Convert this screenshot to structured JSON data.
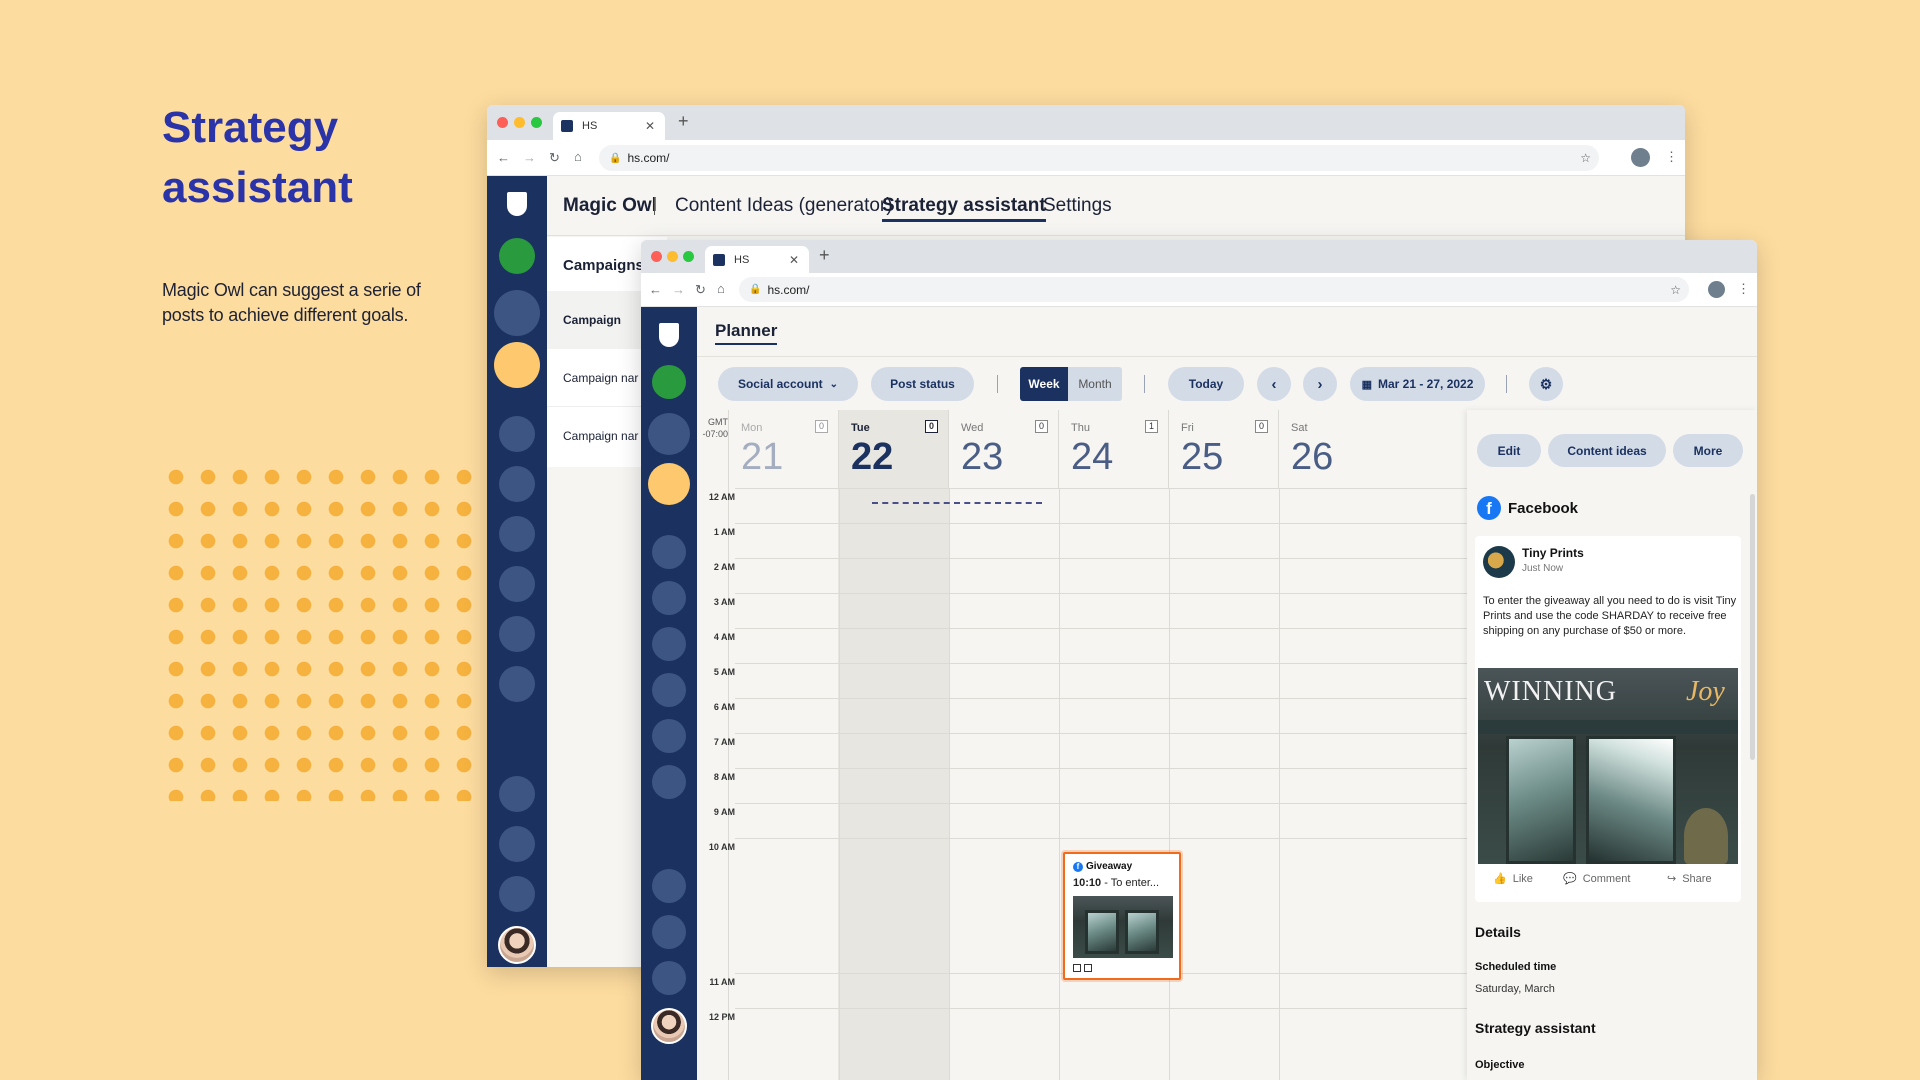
{
  "promo": {
    "title_line1": "Strategy",
    "title_line2": "assistant",
    "description": "Magic Owl can suggest a serie of posts to achieve different goals."
  },
  "back_window": {
    "tab_title": "HS",
    "url": "hs.com/",
    "nav": {
      "brand": "Magic Owl",
      "items": [
        "Content Ideas (generator)",
        "Strategy assistant",
        "Settings"
      ],
      "active": "Strategy assistant"
    },
    "campaigns": {
      "heading": "Campaigns",
      "rows": [
        "Campaign",
        "Campaign nar",
        "Campaign nar"
      ]
    }
  },
  "front_window": {
    "tab_title": "HS",
    "url": "hs.com/",
    "page_title": "Planner",
    "toolbar": {
      "social_account": "Social account",
      "post_status": "Post status",
      "view_week": "Week",
      "view_month": "Month",
      "today": "Today",
      "date_range": "Mar 21 - 27, 2022"
    },
    "calendar": {
      "timezone_line1": "GMT",
      "timezone_line2": "-07:00",
      "days": [
        {
          "name": "Mon",
          "num": "21",
          "count": "0"
        },
        {
          "name": "Tue",
          "num": "22",
          "count": "0"
        },
        {
          "name": "Wed",
          "num": "23",
          "count": "0"
        },
        {
          "name": "Thu",
          "num": "24",
          "count": "1"
        },
        {
          "name": "Fri",
          "num": "25",
          "count": "0"
        },
        {
          "name": "Sat",
          "num": "26",
          "count": ""
        }
      ],
      "hours": [
        "12 AM",
        "1 AM",
        "2 AM",
        "3 AM",
        "4 AM",
        "5 AM",
        "6 AM",
        "7 AM",
        "8 AM",
        "9 AM",
        "10 AM",
        "11 AM",
        "12 PM"
      ],
      "event": {
        "title": "Giveaway",
        "time": "10:10",
        "snippet": "To enter..."
      }
    },
    "panel": {
      "buttons": {
        "edit": "Edit",
        "content_ideas": "Content ideas",
        "more": "More"
      },
      "network": "Facebook",
      "post": {
        "author": "Tiny Prints",
        "time": "Just Now",
        "text": "To enter the giveaway all you need to do is visit Tiny Prints and use the code SHARDAY to receive free shipping on any purchase of $50 or more.",
        "image_text": "WINNING",
        "image_script": "Joy",
        "actions": {
          "like": "Like",
          "comment": "Comment",
          "share": "Share"
        }
      },
      "details_heading": "Details",
      "scheduled_label": "Scheduled time",
      "scheduled_value": "Saturday, March",
      "strategy_heading": "Strategy assistant",
      "objective_label": "Objective"
    }
  },
  "colors": {
    "background": "#fddc9f",
    "title": "#2a33a8",
    "sidebar": "#1b3260",
    "dots": "#f6b23e",
    "accent_green": "#2a9a3f",
    "accent_yellow": "#fdc86e",
    "event_border": "#f26b1d"
  }
}
